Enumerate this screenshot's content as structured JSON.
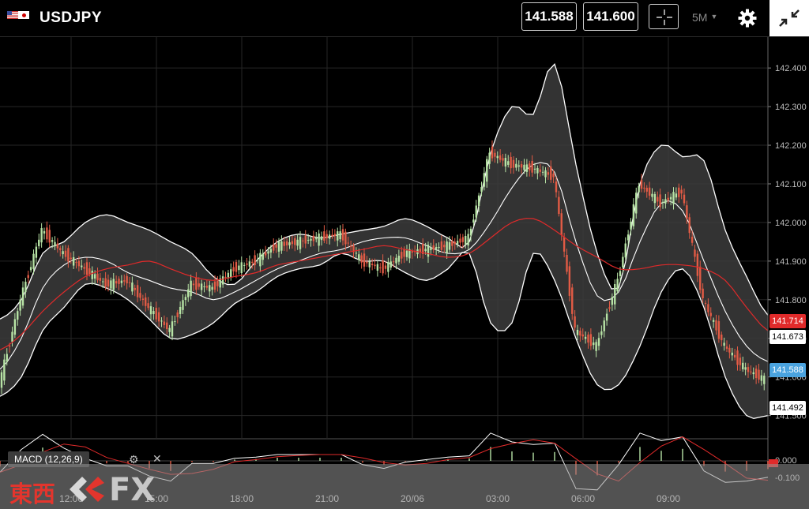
{
  "header": {
    "symbol": "USDJPY",
    "bid": "141.588",
    "ask": "141.600",
    "timeframe": "5M"
  },
  "icons": {
    "flags": [
      "us-flag-icon",
      "jp-flag-icon"
    ],
    "crosshair": "crosshair-icon",
    "settings": "gear-icon",
    "collapse": "collapse-icon",
    "indicator_settings": "gear-icon",
    "indicator_close": "close-icon"
  },
  "colors": {
    "background": "#000000",
    "bull_candle": "#b7e3a5",
    "bear_candle": "#e25b45",
    "band": "#ffffff",
    "band_fill": "#3c3c3c",
    "moving_average": "#e02a2a",
    "price_tag_red": "#e02a2a",
    "price_tag_blue": "#4aa3df"
  },
  "price_tags": {
    "ma": "141.714",
    "band_mid": "141.673",
    "bid": "141.588",
    "band_low": "141.492"
  },
  "indicator": {
    "label": "MACD (12,26,9)",
    "ticks": [
      "0.000",
      "-0.100"
    ]
  },
  "watermark": {
    "brand_cn": "東西",
    "brand_fx": "FX"
  },
  "chart_data": {
    "type": "candlestick",
    "y_ticks": [
      "142.400",
      "142.300",
      "142.200",
      "142.100",
      "142.000",
      "141.900",
      "141.800",
      "141.700",
      "141.600",
      "141.500"
    ],
    "x_ticks": [
      "12:00",
      "15:00",
      "18:00",
      "21:00",
      "20/06",
      "03:00",
      "06:00",
      "09:00"
    ],
    "ylim": [
      141.44,
      142.48
    ],
    "grid": true,
    "series": {
      "upper_band": [
        141.75,
        141.8,
        141.92,
        141.95,
        142.0,
        142.02,
        142.0,
        141.98,
        141.95,
        141.92,
        141.86,
        141.84,
        141.9,
        141.95,
        141.97,
        141.96,
        141.97,
        141.98,
        141.99,
        142.01,
        141.99,
        141.96,
        141.95,
        142.18,
        142.3,
        142.28,
        142.41,
        142.15,
        141.92,
        141.83,
        142.1,
        142.2,
        142.17,
        142.16,
        141.98,
        141.86,
        141.76
      ],
      "middle_band": [
        141.62,
        141.7,
        141.83,
        141.89,
        141.91,
        141.9,
        141.87,
        141.85,
        141.83,
        141.82,
        141.8,
        141.82,
        141.85,
        141.88,
        141.9,
        141.92,
        141.93,
        141.95,
        141.96,
        141.96,
        141.94,
        141.92,
        141.93,
        142.0,
        142.09,
        142.15,
        142.13,
        141.95,
        141.81,
        141.82,
        141.95,
        142.05,
        142.03,
        141.9,
        141.77,
        141.68,
        141.64
      ],
      "lower_band": [
        141.55,
        141.6,
        141.72,
        141.78,
        141.84,
        141.83,
        141.8,
        141.75,
        141.7,
        141.71,
        141.74,
        141.79,
        141.82,
        141.86,
        141.88,
        141.89,
        141.92,
        141.9,
        141.9,
        141.87,
        141.85,
        141.88,
        141.92,
        141.74,
        141.74,
        141.92,
        141.85,
        141.7,
        141.58,
        141.58,
        141.68,
        141.82,
        141.88,
        141.78,
        141.6,
        141.5,
        141.5
      ],
      "moving_average": [
        141.67,
        141.71,
        141.77,
        141.82,
        141.86,
        141.88,
        141.89,
        141.9,
        141.88,
        141.86,
        141.85,
        141.86,
        141.87,
        141.89,
        141.9,
        141.91,
        141.92,
        141.93,
        141.94,
        141.93,
        141.92,
        141.91,
        141.92,
        141.96,
        142.0,
        142.01,
        141.98,
        141.94,
        141.91,
        141.88,
        141.88,
        141.89,
        141.89,
        141.88,
        141.85,
        141.78,
        141.72
      ],
      "close": [
        141.58,
        141.8,
        141.98,
        141.92,
        141.88,
        141.84,
        141.85,
        141.78,
        141.72,
        141.84,
        141.83,
        141.88,
        141.9,
        141.94,
        141.95,
        141.96,
        141.97,
        141.9,
        141.88,
        141.92,
        141.93,
        141.94,
        141.96,
        142.18,
        142.15,
        142.14,
        142.12,
        141.72,
        141.68,
        141.85,
        142.1,
        142.05,
        142.08,
        141.8,
        141.68,
        141.62,
        141.59
      ]
    }
  }
}
